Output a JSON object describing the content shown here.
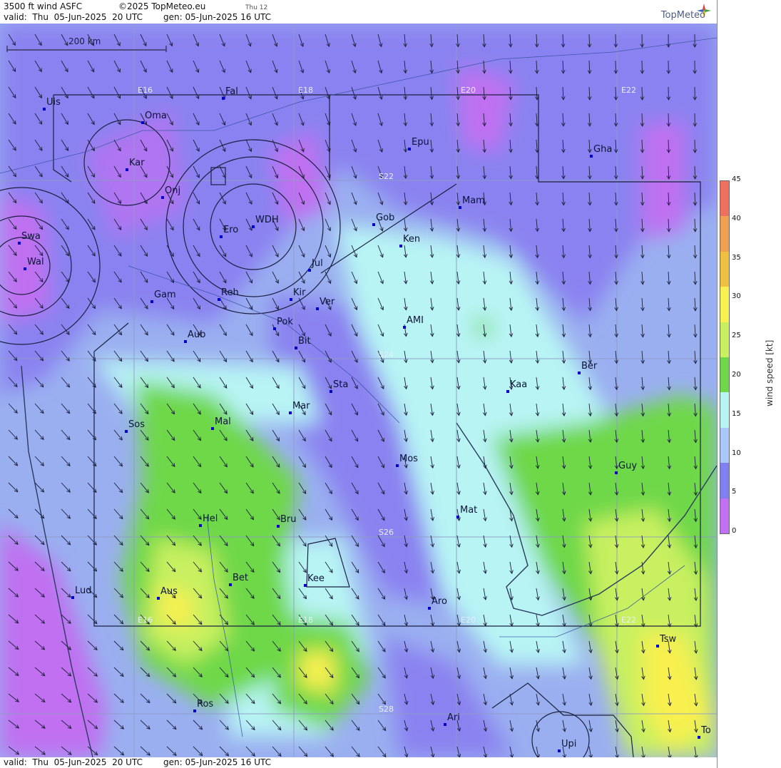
{
  "header": {
    "product": "3500 ft wind ASFC",
    "copyright": "©2025 TopMeteo.eu",
    "step": "Thu 12",
    "valid": "valid:  Thu  05-Jun-2025  20 UTC",
    "generated": "gen: 05-Jun-2025 16 UTC",
    "logo_text": "TopMeteo"
  },
  "footer": {
    "valid": "valid:  Thu  05-Jun-2025  20 UTC",
    "generated": "gen: 05-Jun-2025 16 UTC"
  },
  "scale_bar": {
    "label": "200 km"
  },
  "legend": {
    "title": "wind speed [kt]",
    "ticks": [
      "45",
      "40",
      "35",
      "30",
      "25",
      "20",
      "15",
      "10",
      "5",
      "0"
    ],
    "colors": [
      "#f07060",
      "#f0a050",
      "#f0c040",
      "#f8f050",
      "#c8f060",
      "#6ed848",
      "#b8f4f4",
      "#a8c8f8",
      "#8080f0",
      "#c070f0"
    ]
  },
  "grid_labels": {
    "longitudes": [
      "E16",
      "E18",
      "E20",
      "E22"
    ],
    "latitudes": [
      "S22",
      "S24",
      "S26",
      "S28"
    ]
  },
  "cities": [
    {
      "name": "Uis"
    },
    {
      "name": "Fal"
    },
    {
      "name": "Oma"
    },
    {
      "name": "Kar"
    },
    {
      "name": "Epu"
    },
    {
      "name": "Gha"
    },
    {
      "name": "Onj"
    },
    {
      "name": "Mam"
    },
    {
      "name": "Gob"
    },
    {
      "name": "WDH"
    },
    {
      "name": "Ero"
    },
    {
      "name": "Ken"
    },
    {
      "name": "Swa"
    },
    {
      "name": "Wal"
    },
    {
      "name": "Jul"
    },
    {
      "name": "Gam"
    },
    {
      "name": "Reh"
    },
    {
      "name": "Kir"
    },
    {
      "name": "Ver"
    },
    {
      "name": "AMI"
    },
    {
      "name": "Pok"
    },
    {
      "name": "Aub"
    },
    {
      "name": "Bit"
    },
    {
      "name": "Ber"
    },
    {
      "name": "Sta"
    },
    {
      "name": "Kaa"
    },
    {
      "name": "Mar"
    },
    {
      "name": "Sos"
    },
    {
      "name": "Mal"
    },
    {
      "name": "Mos"
    },
    {
      "name": "Guy"
    },
    {
      "name": "Mat"
    },
    {
      "name": "Hel"
    },
    {
      "name": "Bru"
    },
    {
      "name": "Bet"
    },
    {
      "name": "Kee"
    },
    {
      "name": "Lud"
    },
    {
      "name": "Aus"
    },
    {
      "name": "Aro"
    },
    {
      "name": "Tsw"
    },
    {
      "name": "Ros"
    },
    {
      "name": "Ari"
    },
    {
      "name": "To"
    },
    {
      "name": "Upi"
    }
  ],
  "colors": {
    "water": "#c070f0",
    "low": "#8080f0",
    "mid": "#a8c8f8",
    "light": "#b8f4f4",
    "green": "#6ed848",
    "yellow": "#f8f050"
  }
}
